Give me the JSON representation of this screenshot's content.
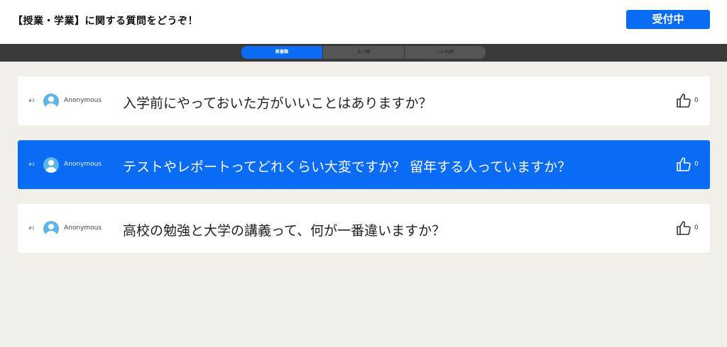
{
  "header": {
    "title": "【授業・学業】に関する質問をどうぞ！",
    "status_label": "受付中"
  },
  "tabs": [
    {
      "label": "新着順",
      "active": true
    },
    {
      "label": "古い順",
      "active": false
    },
    {
      "label": "いいね順",
      "active": false
    }
  ],
  "questions": [
    {
      "number": "#3",
      "author": "Anonymous",
      "text": "入学前にやっておいた方がいいことはありますか？",
      "likes": "0",
      "highlighted": false
    },
    {
      "number": "#2",
      "author": "Anonymous",
      "text": "テストやレポートってどれくらい大変ですか？ 留年する人っていますか？",
      "likes": "0",
      "highlighted": true
    },
    {
      "number": "#1",
      "author": "Anonymous",
      "text": "高校の勉強と大学の講義って、何が一番違いますか？",
      "likes": "0",
      "highlighted": false
    }
  ],
  "colors": {
    "accent": "#0a6cf5",
    "background": "#f2efeb",
    "tabbar": "#3a3a3a",
    "avatar": "#5fb4e8"
  },
  "icons": {
    "avatar": "user-avatar-icon",
    "like": "thumbs-up-icon"
  }
}
